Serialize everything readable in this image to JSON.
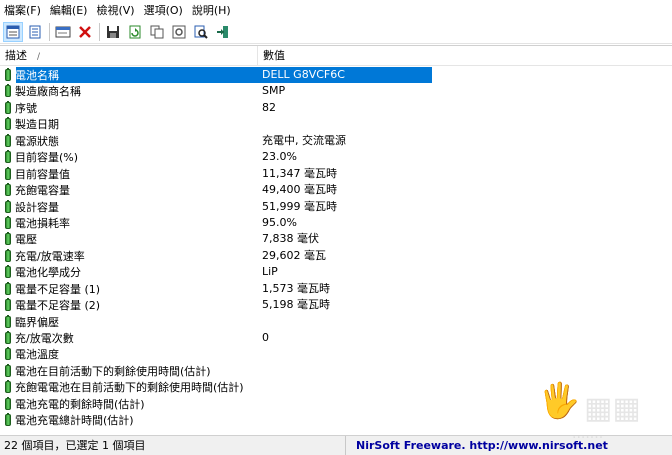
{
  "menu": [
    {
      "label": "檔案(F)"
    },
    {
      "label": "編輯(E)"
    },
    {
      "label": "檢視(V)"
    },
    {
      "label": "選項(O)"
    },
    {
      "label": "說明(H)"
    }
  ],
  "toolbar": {
    "buttons": [
      {
        "icon": "html-report-icon"
      },
      {
        "icon": "copy-list-icon"
      },
      {
        "icon": "properties-icon"
      },
      {
        "icon": "delete-icon"
      },
      {
        "icon": "save-icon"
      },
      {
        "icon": "refresh-icon"
      },
      {
        "icon": "copy-icon"
      },
      {
        "icon": "options-icon"
      },
      {
        "icon": "find-icon"
      },
      {
        "icon": "exit-icon"
      }
    ]
  },
  "list": {
    "columns": {
      "description": "描述",
      "value": "數值"
    },
    "rows": [
      {
        "desc": "電池名稱",
        "value": "DELL G8VCF6C",
        "selected": true
      },
      {
        "desc": "製造廠商名稱",
        "value": "SMP"
      },
      {
        "desc": "序號",
        "value": "82"
      },
      {
        "desc": "製造日期",
        "value": ""
      },
      {
        "desc": "電源狀態",
        "value": "充電中, 交流電源"
      },
      {
        "desc": "目前容量(%)",
        "value": "23.0%"
      },
      {
        "desc": "目前容量值",
        "value": "11,347 毫瓦時"
      },
      {
        "desc": "充飽電容量",
        "value": "49,400 毫瓦時"
      },
      {
        "desc": "設計容量",
        "value": "51,999 毫瓦時"
      },
      {
        "desc": "電池損耗率",
        "value": "95.0%"
      },
      {
        "desc": "電壓",
        "value": "7,838 毫伏"
      },
      {
        "desc": "充電/放電速率",
        "value": "29,602 毫瓦"
      },
      {
        "desc": "電池化學成分",
        "value": "LiP"
      },
      {
        "desc": "電量不足容量 (1)",
        "value": "1,573 毫瓦時"
      },
      {
        "desc": "電量不足容量 (2)",
        "value": "5,198 毫瓦時"
      },
      {
        "desc": "臨界偏壓",
        "value": ""
      },
      {
        "desc": "充/放電次數",
        "value": "0"
      },
      {
        "desc": "電池溫度",
        "value": ""
      },
      {
        "desc": "電池在目前活動下的剩餘使用時間(估計)",
        "value": ""
      },
      {
        "desc": "充飽電電池在目前活動下的剩餘使用時間(估計)",
        "value": ""
      },
      {
        "desc": "電池充電的剩餘時間(估計)",
        "value": ""
      },
      {
        "desc": "電池充電總計時間(估計)",
        "value": ""
      }
    ]
  },
  "status": {
    "items": "22 個項目，已選定 1 個項目",
    "credit": "NirSoft Freeware.  http://www.nirsoft.net"
  },
  "colors": {
    "selection": "#0078d7",
    "battery": "#3fae3f",
    "credit": "#0000a0"
  }
}
